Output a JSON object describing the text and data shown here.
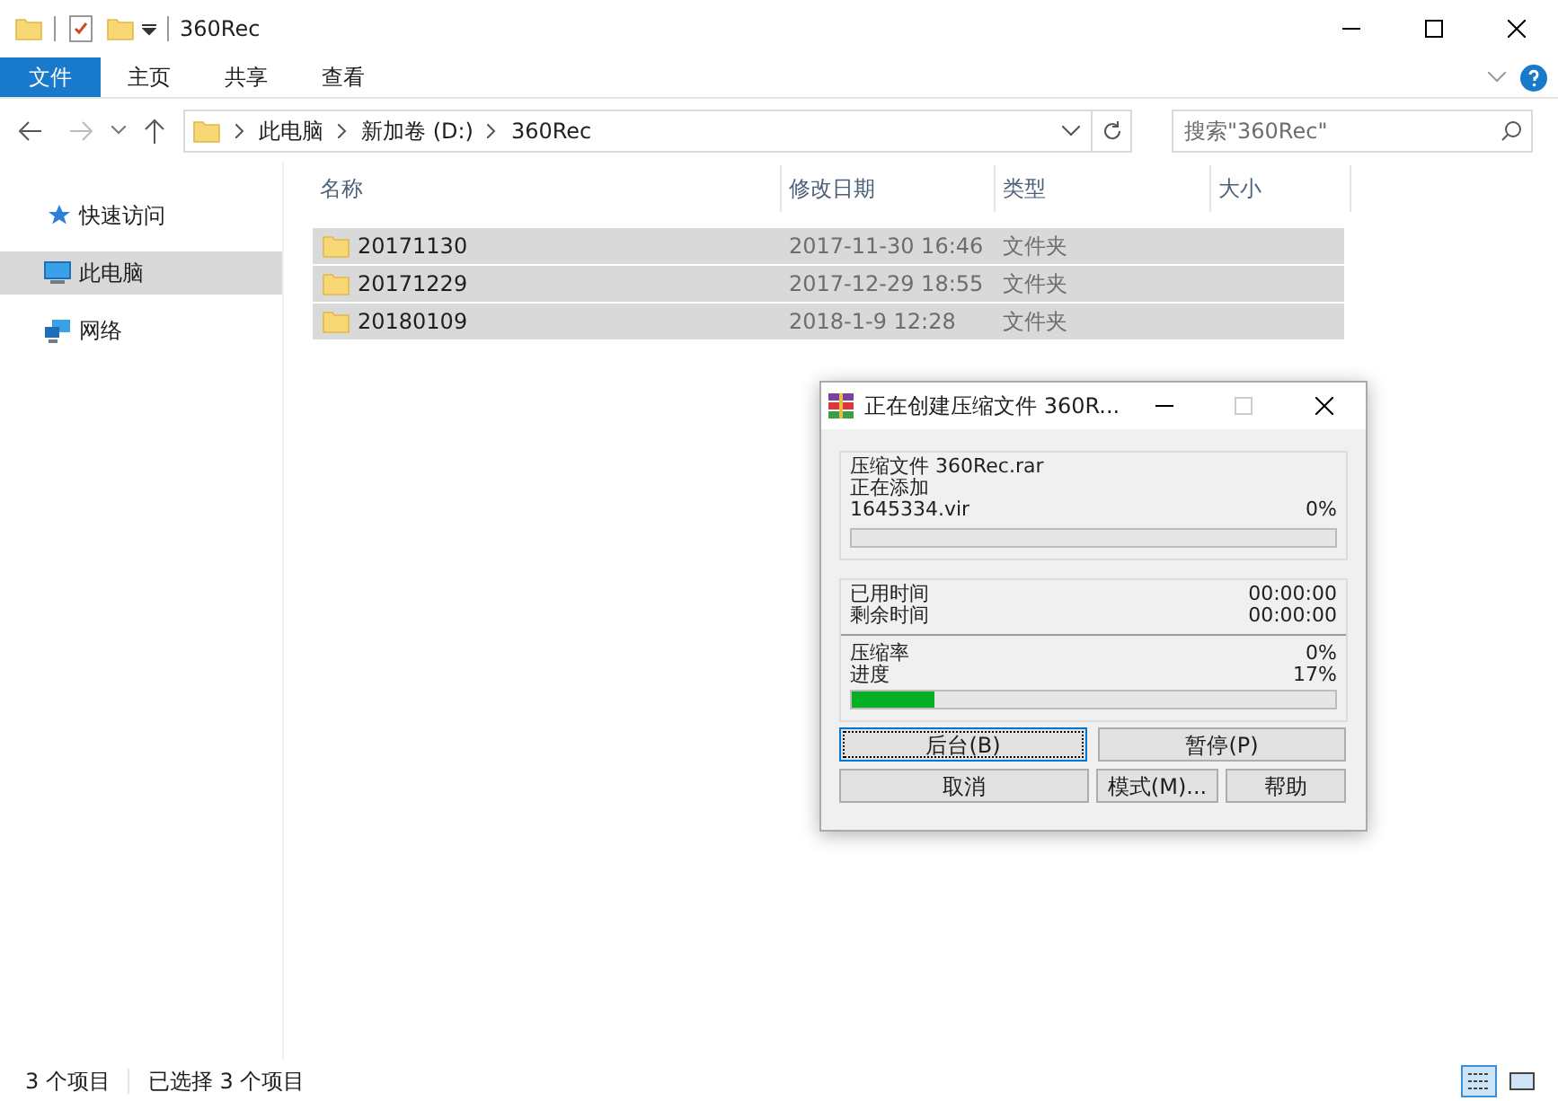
{
  "window": {
    "title": "360Rec"
  },
  "ribbon_tabs": [
    {
      "label": "文件",
      "selected": true
    },
    {
      "label": "主页",
      "selected": false
    },
    {
      "label": "共享",
      "selected": false
    },
    {
      "label": "查看",
      "selected": false
    }
  ],
  "breadcrumb": [
    "此电脑",
    "新加卷 (D:)",
    "360Rec"
  ],
  "search": {
    "placeholder": "搜索\"360Rec\""
  },
  "sidebar": {
    "items": [
      {
        "label": "快速访问",
        "kind": "star",
        "selected": false
      },
      {
        "label": "此电脑",
        "kind": "pc",
        "selected": true
      },
      {
        "label": "网络",
        "kind": "network",
        "selected": false
      }
    ]
  },
  "table": {
    "columns": [
      "名称",
      "修改日期",
      "类型",
      "大小"
    ],
    "rows": [
      {
        "name": "20171130",
        "date": "2017-11-30 16:46",
        "type": "文件夹",
        "selected": true
      },
      {
        "name": "20171229",
        "date": "2017-12-29 18:55",
        "type": "文件夹",
        "selected": true
      },
      {
        "name": "20180109",
        "date": "2018-1-9 12:28",
        "type": "文件夹",
        "selected": true
      }
    ]
  },
  "status_bar": {
    "count": "3 个项目",
    "selection": "已选择 3 个项目"
  },
  "dialog": {
    "title": "正在创建压缩文件 360R...",
    "archive_label": "压缩文件 360Rec.rar",
    "adding_label": "正在添加",
    "file": "1645334.vir",
    "file_percent": "0%",
    "file_bar": {
      "level": 0
    },
    "elapsed_label": "已用时间",
    "elapsed": "00:00:00",
    "remaining_label": "剩余时间",
    "remaining": "00:00:00",
    "ratio_label": "压缩率",
    "ratio": "0%",
    "progress_label": "进度",
    "progress": "17%",
    "progress_bar": {
      "level": 0.17
    },
    "buttons": [
      {
        "label": "后台(B)",
        "selected": true
      },
      {
        "label": "暂停(P)",
        "selected": false
      },
      {
        "label": "取消",
        "selected": false
      },
      {
        "label": "模式(M)...",
        "selected": false
      },
      {
        "label": "帮助",
        "selected": false
      }
    ]
  }
}
